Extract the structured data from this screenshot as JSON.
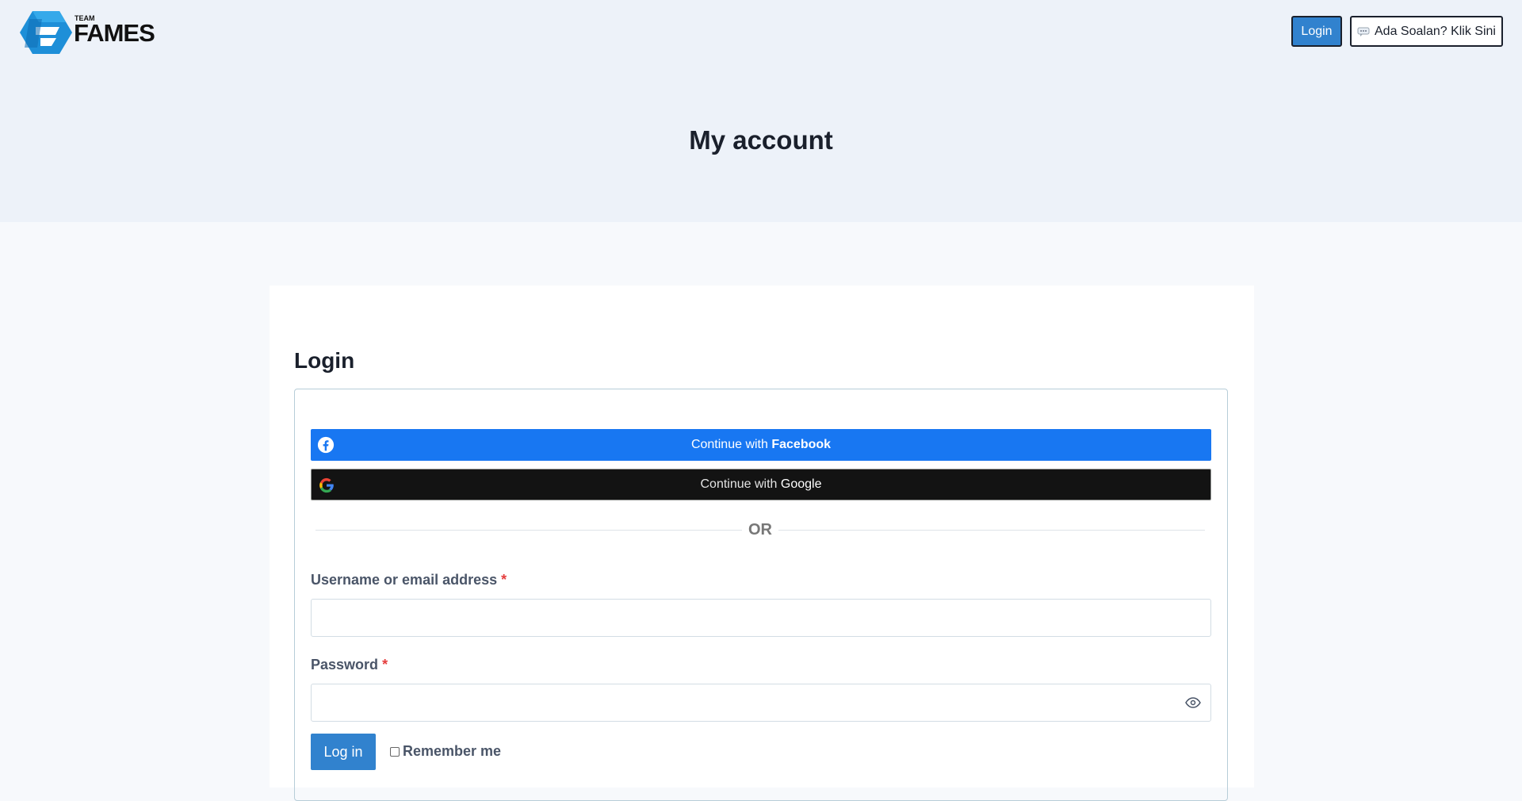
{
  "brand": {
    "logo_small_text": "TEAM",
    "logo_main_text": "FAMES",
    "colors": {
      "primary": "#3182ce",
      "facebook": "#1877f2",
      "google_bg": "#131313",
      "logo_blue": "#1e8fd8"
    }
  },
  "header": {
    "login_label": "Login",
    "question_icon": "speech-bubble-icon",
    "question_label": "Ada Soalan? Klik Sini"
  },
  "page": {
    "title": "My account"
  },
  "login": {
    "heading": "Login",
    "facebook": {
      "prefix": "Continue with ",
      "brand": "Facebook",
      "icon": "facebook-icon"
    },
    "google": {
      "prefix": "Continue with ",
      "brand": "Google",
      "icon": "google-icon"
    },
    "or_text": "OR",
    "username_label": "Username or email address",
    "password_label": "Password",
    "required_marker": "*",
    "username_value": "",
    "password_value": "",
    "submit_label": "Log in",
    "remember_label": "Remember me"
  }
}
